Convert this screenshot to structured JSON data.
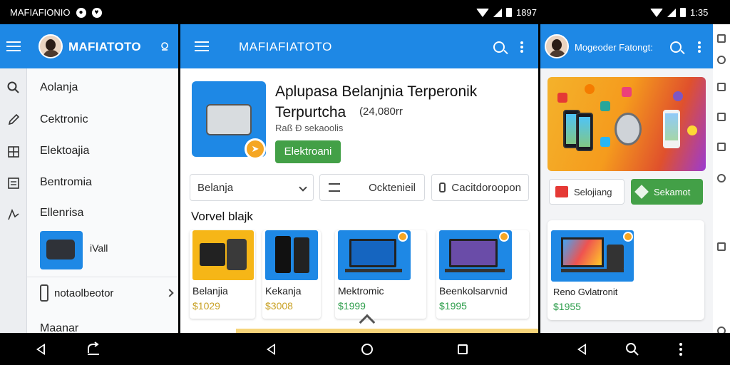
{
  "status_bar": {
    "left_text": "MAFIAFIONIO",
    "middle_time": "1897",
    "right_time": "1:35"
  },
  "left_panel": {
    "brand": "MAFIATOTO",
    "menu_items": [
      "Aolanja",
      "Cektronic",
      "Elektoajia",
      "Bentromia",
      "Ellenrisa"
    ],
    "thumb_label": "iVall",
    "row_label": "notaolbeotor",
    "bottom_label": "Maanar"
  },
  "middle_panel": {
    "brand": "MAFIAFIATOTO",
    "hero": {
      "title_line1": "Aplupasa Belanjnia Terperonik",
      "title_line2": "Terpurtcha",
      "price": "(24,080rr",
      "subtitle": "Raß Ð sekaoolis",
      "button": "Elektroani"
    },
    "filters": {
      "dropdown_value": "Belanja",
      "chip2": "Ocktenieil",
      "chip3": "Cacitdoroopon"
    },
    "section_title": "Vorvel blajk",
    "products": [
      {
        "name": "Belanjia",
        "price": "$1029"
      },
      {
        "name": "Kekanja",
        "price": "$3008"
      },
      {
        "name": "Mektromic",
        "price": "$1999"
      },
      {
        "name": "Beenkolsarvnid",
        "price": "$1995"
      }
    ],
    "price_colors": {
      "gold": "#c9a227",
      "green": "#2e9e4c"
    }
  },
  "right_panel": {
    "title": "Mogeoder Fatongt:",
    "btn_left": "Selojiang",
    "btn_right": "Sekamot",
    "card": {
      "name": "Reno Gvlatronit",
      "price": "$1955"
    }
  },
  "colors": {
    "primary": "#1e88e5",
    "success": "#43a047",
    "accent": "#f5a623"
  }
}
